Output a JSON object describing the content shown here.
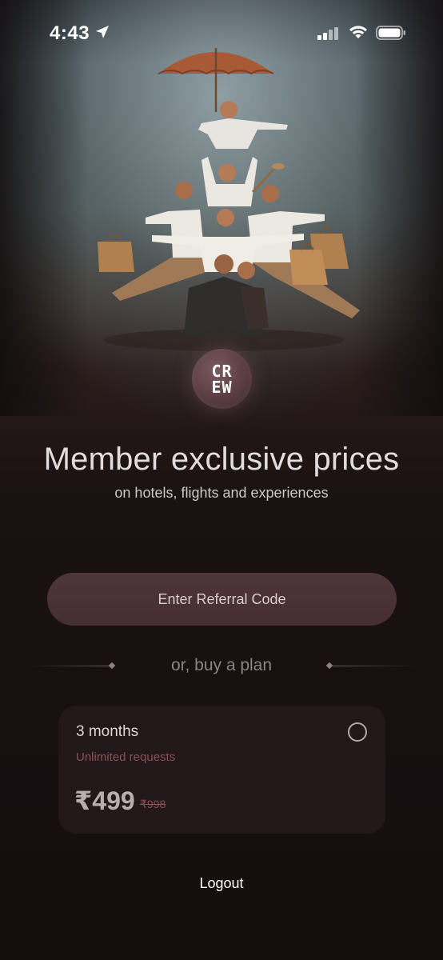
{
  "status_bar": {
    "time": "4:43",
    "icons": [
      "location-arrow-icon",
      "signal-icon",
      "wifi-icon",
      "battery-icon"
    ]
  },
  "hero": {
    "icon": "crew-travellers-illustration"
  },
  "logo": {
    "text_line1": "CR",
    "text_line2": "EW"
  },
  "headline": "Member exclusive prices",
  "subheadline": "on hotels, flights and experiences",
  "referral_button": {
    "label": "Enter Referral Code"
  },
  "divider": {
    "label": "or, buy a plan"
  },
  "plan": {
    "name": "3 months",
    "description": "Unlimited requests",
    "price": "₹499",
    "original_price": "₹998",
    "selected": false
  },
  "logout": {
    "label": "Logout"
  },
  "colors": {
    "background": "#140d0e",
    "button": "#4a3236",
    "card": "#221719",
    "accent_muted": "#8a5058"
  }
}
